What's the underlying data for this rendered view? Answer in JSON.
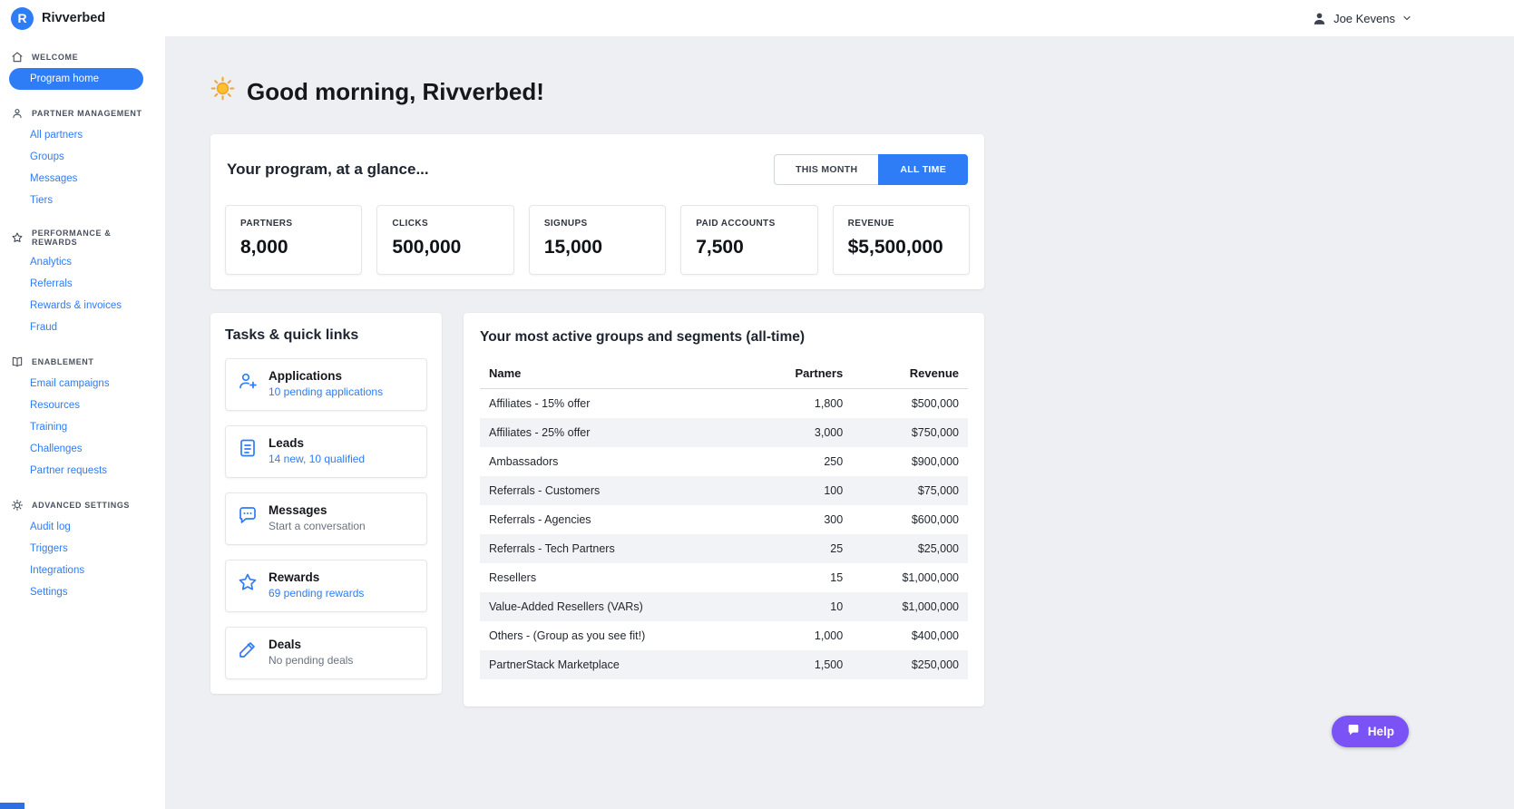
{
  "colors": {
    "accent_blue": "#2e7cf6",
    "help_purple": "#7a52f6",
    "page_bg": "#edeff2",
    "row_stripe": "#f2f3f6"
  },
  "topbar": {
    "logo_letter": "R",
    "brand": "Rivverbed",
    "user": "Joe Kevens"
  },
  "sidebar": {
    "sections": [
      {
        "label": "WELCOME",
        "icon": "home-icon",
        "items": [
          {
            "label": "Program home",
            "active": true
          }
        ]
      },
      {
        "label": "PARTNER MANAGEMENT",
        "icon": "person-icon",
        "items": [
          {
            "label": "All partners"
          },
          {
            "label": "Groups"
          },
          {
            "label": "Messages"
          },
          {
            "label": "Tiers"
          }
        ]
      },
      {
        "label": "PERFORMANCE & REWARDS",
        "icon": "star-icon",
        "items": [
          {
            "label": "Analytics"
          },
          {
            "label": "Referrals"
          },
          {
            "label": "Rewards & invoices"
          },
          {
            "label": "Fraud"
          }
        ]
      },
      {
        "label": "ENABLEMENT",
        "icon": "book-icon",
        "items": [
          {
            "label": "Email campaigns"
          },
          {
            "label": "Resources"
          },
          {
            "label": "Training"
          },
          {
            "label": "Challenges"
          },
          {
            "label": "Partner requests"
          }
        ]
      },
      {
        "label": "ADVANCED SETTINGS",
        "icon": "gear-icon",
        "items": [
          {
            "label": "Audit log"
          },
          {
            "label": "Triggers"
          },
          {
            "label": "Integrations"
          },
          {
            "label": "Settings"
          }
        ]
      }
    ]
  },
  "main": {
    "greeting": "Good morning, Rivverbed!",
    "glance": {
      "title": "Your program, at a glance...",
      "toggles": [
        {
          "label": "THIS MONTH",
          "active": false
        },
        {
          "label": "ALL TIME",
          "active": true
        }
      ],
      "stats": [
        {
          "label": "PARTNERS",
          "value": "8,000"
        },
        {
          "label": "CLICKS",
          "value": "500,000"
        },
        {
          "label": "SIGNUPS",
          "value": "15,000"
        },
        {
          "label": "PAID ACCOUNTS",
          "value": "7,500"
        },
        {
          "label": "REVENUE",
          "value": "$5,500,000"
        }
      ]
    },
    "tasks": {
      "title": "Tasks & quick links",
      "items": [
        {
          "title": "Applications",
          "subtitle": "10 pending applications",
          "icon": "person-add-icon",
          "link": true
        },
        {
          "title": "Leads",
          "subtitle": "14 new, 10 qualified",
          "icon": "document-icon",
          "link": true
        },
        {
          "title": "Messages",
          "subtitle": "Start a conversation",
          "icon": "chat-icon",
          "link": false
        },
        {
          "title": "Rewards",
          "subtitle": "69 pending rewards",
          "icon": "star-icon",
          "link": true
        },
        {
          "title": "Deals",
          "subtitle": "No pending deals",
          "icon": "pencil-icon",
          "link": false
        }
      ]
    },
    "groups": {
      "title": "Your most active groups and segments (all-time)",
      "columns": [
        "Name",
        "Partners",
        "Revenue"
      ],
      "rows": [
        [
          "Affiliates - 15% offer",
          "1,800",
          "$500,000"
        ],
        [
          "Affiliates - 25% offer",
          "3,000",
          "$750,000"
        ],
        [
          "Ambassadors",
          "250",
          "$900,000"
        ],
        [
          "Referrals - Customers",
          "100",
          "$75,000"
        ],
        [
          "Referrals - Agencies",
          "300",
          "$600,000"
        ],
        [
          "Referrals - Tech Partners",
          "25",
          "$25,000"
        ],
        [
          "Resellers",
          "15",
          "$1,000,000"
        ],
        [
          "Value-Added Resellers (VARs)",
          "10",
          "$1,000,000"
        ],
        [
          "Others - (Group as you see fit!)",
          "1,000",
          "$400,000"
        ],
        [
          "PartnerStack Marketplace",
          "1,500",
          "$250,000"
        ]
      ]
    }
  },
  "help": {
    "label": "Help"
  }
}
